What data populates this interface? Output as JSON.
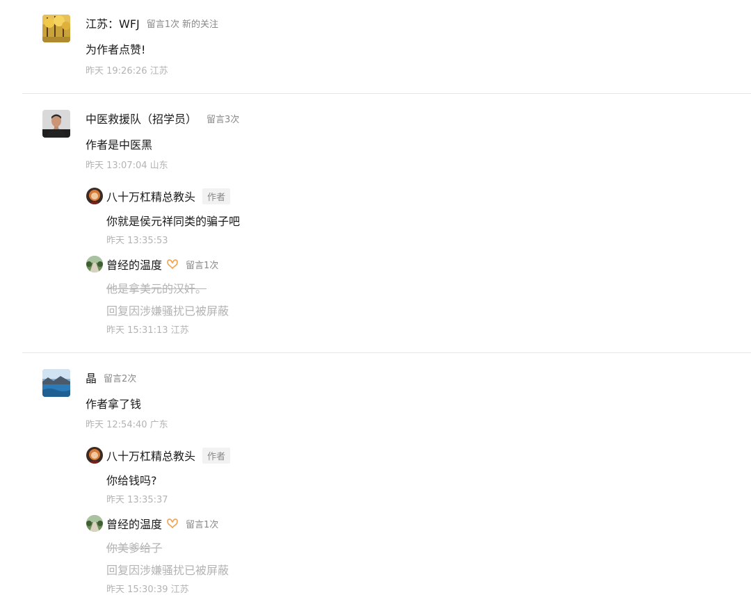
{
  "comments": [
    {
      "name": "江苏：WFJ",
      "count": "留言1次",
      "tag": "新的关注",
      "text": "为作者点赞!",
      "time": "昨天 19:26:26 江苏"
    },
    {
      "name": "中医救援队（招学员）",
      "count": "留言3次",
      "text": "作者是中医黑",
      "time": "昨天 13:07:04 山东",
      "replies": [
        {
          "name": "八十万杠精总教头",
          "badge": "作者",
          "text": "你就是侯元祥同类的骗子吧",
          "time": "昨天 13:35:53"
        },
        {
          "name": "曾经的温度",
          "count": "留言1次",
          "text": "他是拿美元的汉奸。",
          "blocked": "回复因涉嫌骚扰已被屏蔽",
          "time": "昨天 15:31:13 江苏"
        }
      ]
    },
    {
      "name": "晶",
      "count": "留言2次",
      "text": "作者拿了钱",
      "time": "昨天 12:54:40 广东",
      "replies": [
        {
          "name": "八十万杠精总教头",
          "badge": "作者",
          "text": "你给钱吗?",
          "time": "昨天 13:35:37"
        },
        {
          "name": "曾经的温度",
          "count": "留言1次",
          "text": "你美爹给子",
          "blocked": "回复因涉嫌骚扰已被屏蔽",
          "time": "昨天 15:30:39 江苏"
        }
      ]
    }
  ],
  "icons": {
    "avatar_1": "ginkgo-tree-avatar-icon",
    "avatar_2": "man-portrait-avatar-icon",
    "avatar_3": "lake-landscape-avatar-icon",
    "reply_avatar_author": "author-avatar-icon",
    "reply_avatar_user": "road-landscape-avatar-icon",
    "wing": "orange-wing-badge-icon"
  },
  "colors": {
    "wing": "#f5a04a",
    "meta": "#888888",
    "muted": "#b3b3b3",
    "divider": "#e6e6e6"
  }
}
